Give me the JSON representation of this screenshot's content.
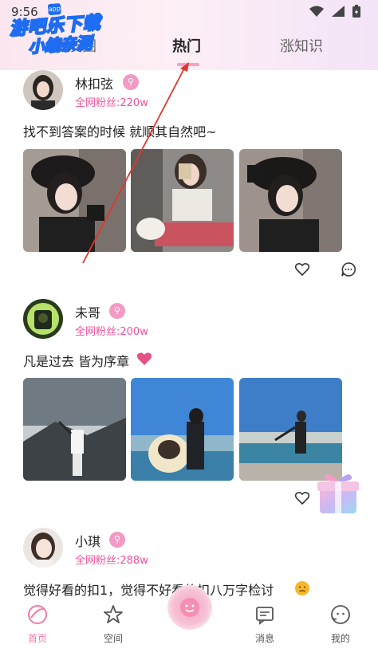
{
  "status_bar": {
    "time": "9:56"
  },
  "watermark": {
    "line1": "游吧乐下载",
    "line2": "小编亲测",
    "badge": "app"
  },
  "tabs": [
    {
      "label": "朋友圈",
      "active": false
    },
    {
      "label": "热门",
      "active": true
    },
    {
      "label": "涨知识",
      "active": false
    }
  ],
  "posts": [
    {
      "username": "林扣弦",
      "fans": "全网粉丝:220w",
      "text": "找不到答案的时候 就顺其自然吧~"
    },
    {
      "username": "未哥",
      "fans": "全网粉丝:200w",
      "text": "凡是过去 皆为序章"
    },
    {
      "username": "小琪",
      "fans": "全网粉丝:288w",
      "text": "觉得好看的扣1，觉得不好看的扣八万字检讨"
    }
  ],
  "bottom_nav": [
    {
      "label": "首页",
      "icon": "home-icon",
      "active": true
    },
    {
      "label": "空间",
      "icon": "star-icon",
      "active": false
    },
    {
      "label": "消息",
      "icon": "message-icon",
      "active": false
    },
    {
      "label": "我的",
      "icon": "profile-icon",
      "active": false
    }
  ],
  "colors": {
    "accent": "#f27aa7",
    "fans": "#f0529b",
    "header_bg": "#fbe6ef"
  }
}
